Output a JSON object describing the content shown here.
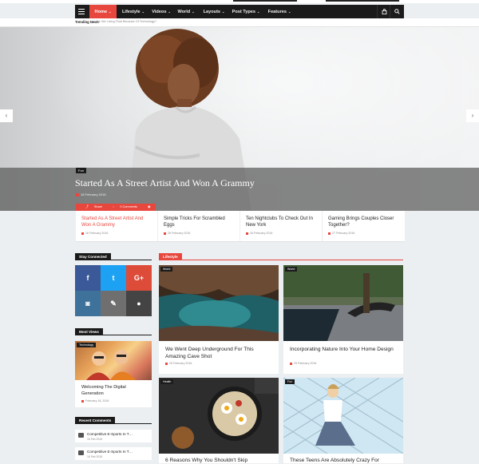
{
  "nav": {
    "items": [
      {
        "label": "Home",
        "active": true
      },
      {
        "label": "Lifestyle"
      },
      {
        "label": "Videos"
      },
      {
        "label": "World"
      },
      {
        "label": "Layouts"
      },
      {
        "label": "Post Types"
      },
      {
        "label": "Features"
      }
    ],
    "chevron": "⌄",
    "menu_icon": "hamburger-icon",
    "bag_icon": "bag-icon",
    "search_icon": "search-icon"
  },
  "trending": {
    "label": "Trending News",
    "text": "Are We Living Fluid Because Of Technology?"
  },
  "hero": {
    "category": "Fun",
    "title": "Started As A Street Artist And Won A Grammy",
    "date": "16 February 2016",
    "share_label": "Share",
    "comments": "0 Comments",
    "views": "1 Views",
    "prev_icon": "‹",
    "next_icon": "›"
  },
  "slides": [
    {
      "title": "Started As A Street Artist And Won A Grammy",
      "date": "16 February 2016"
    },
    {
      "title": "Simple Tricks For Scrambled Eggs",
      "date": "26 February 2016"
    },
    {
      "title": "Ten Nightclubs To Check Out In New York",
      "date": "16 February 2016"
    },
    {
      "title": "Gaming Brings Couples Closer Together?",
      "date": "27 February 2016"
    }
  ],
  "sidebar": {
    "stay_connected": "Stay Connected",
    "social": [
      {
        "name": "facebook",
        "glyph": "f",
        "color": "#3b5998"
      },
      {
        "name": "twitter",
        "glyph": "t",
        "color": "#1da1f2"
      },
      {
        "name": "googleplus",
        "glyph": "G+",
        "color": "#dd4b39"
      },
      {
        "name": "instagram",
        "glyph": "◙",
        "color": "#3f729b"
      },
      {
        "name": "edit",
        "glyph": "✎",
        "color": "#6f6f6f"
      },
      {
        "name": "chat",
        "glyph": "●",
        "color": "#444444"
      }
    ],
    "most_views": "Most Views",
    "most_views_item": {
      "category": "Technology",
      "title": "Welcoming The Digital Generation",
      "date": "February 18, 2016"
    },
    "recent_comments": "Recent Comments",
    "comments": [
      {
        "title": "Competitive E-Sports In T…",
        "date": "16 Feb 2016"
      },
      {
        "title": "Competitive E-Sports In T…",
        "date": "16 Feb 2016"
      }
    ]
  },
  "lifestyle": {
    "label": "Lifestyle",
    "cards": [
      {
        "badge": "World",
        "title": "We Went Deep Underground For This Amazing Cave Shot",
        "date": "25 February 2016"
      },
      {
        "badge": "World",
        "title": "Incorporating Nature Into Your Home Design",
        "date": "25 February 2016"
      },
      {
        "badge": "Health",
        "title": "6 Reasons Why You Shouldn't Skip",
        "date": ""
      },
      {
        "badge": "Fun",
        "title": "These Teens Are Absolutely Crazy For",
        "date": ""
      }
    ]
  }
}
